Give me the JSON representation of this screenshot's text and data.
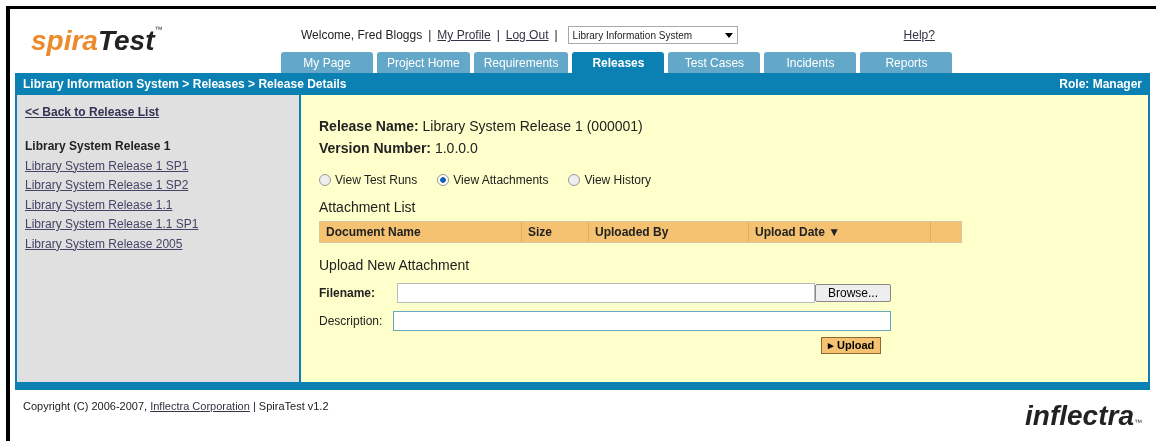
{
  "logo": {
    "text_1": "spira",
    "text_2": "Test",
    "tm": "™"
  },
  "user_bar": {
    "welcome": "Welcome, Fred Bloggs",
    "separator_1": "|",
    "profile_link": "My Profile",
    "separator_2": "|",
    "logout_link": "Log Out",
    "separator_3": "|",
    "project_select": "Library Information System",
    "help_link": "Help?"
  },
  "tabs": [
    {
      "label": "My Page",
      "selected": false
    },
    {
      "label": "Project Home",
      "selected": false
    },
    {
      "label": "Requirements",
      "selected": false
    },
    {
      "label": "Releases",
      "selected": true
    },
    {
      "label": "Test Cases",
      "selected": false
    },
    {
      "label": "Incidents",
      "selected": false
    },
    {
      "label": "Reports",
      "selected": false
    }
  ],
  "breadcrumb": "Library Information System > Releases > Release Details",
  "role": "Role: Manager",
  "sidebar": {
    "back_link": "<< Back to Release List",
    "items": [
      {
        "label": "Library System Release 1",
        "selected": true
      },
      {
        "label": "Library System Release 1 SP1",
        "selected": false
      },
      {
        "label": "Library System Release 1 SP2",
        "selected": false
      },
      {
        "label": "Library System Release 1.1",
        "selected": false
      },
      {
        "label": "Library System Release 1.1 SP1",
        "selected": false
      },
      {
        "label": "Library System Release 2005",
        "selected": false
      }
    ]
  },
  "details": [
    {
      "label": "Release Name:",
      "value": "Library System Release 1 (000001)"
    },
    {
      "label": "Version Number:",
      "value": "1.0.0.0"
    }
  ],
  "views": [
    {
      "label": "View Test Runs",
      "selected": false
    },
    {
      "label": "View Attachments",
      "selected": true
    },
    {
      "label": "View History",
      "selected": false
    }
  ],
  "attachment_list": {
    "title": "Attachment List",
    "columns": [
      {
        "label": "Document Name",
        "sorted": false
      },
      {
        "label": "Size",
        "sorted": false
      },
      {
        "label": "Uploaded By",
        "sorted": false
      },
      {
        "label": "Upload Date",
        "sorted": true,
        "sort_icon": "▼"
      }
    ]
  },
  "upload": {
    "title": "Upload New Attachment",
    "filename_label": "Filename:",
    "browse_button": "Browse...",
    "description_label": "Description:",
    "upload_button_icon": "▸",
    "upload_button": "Upload"
  },
  "footer": {
    "copyright": "Copyright (C) 2006-2007,",
    "company_link": "Inflectra Corporation",
    "product": "| SpiraTest v1.2",
    "brand": "inflectra",
    "brand_tm": "™"
  }
}
